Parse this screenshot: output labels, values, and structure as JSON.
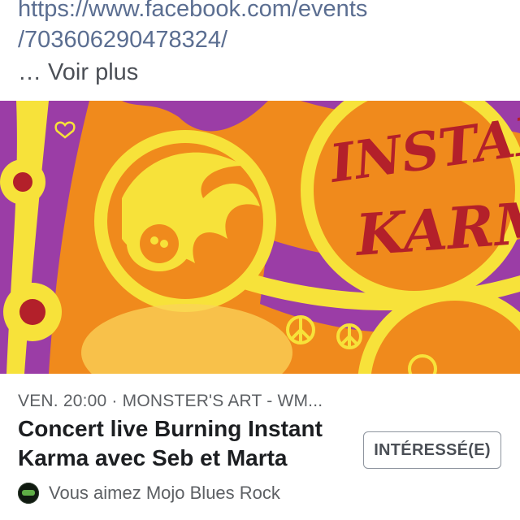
{
  "post": {
    "url_line1": "https://www.facebook.com/events",
    "url_line2": "/703606290478324/",
    "see_more": "… Voir plus"
  },
  "cover": {
    "alt_text": "INSTANT KARMA",
    "colors": {
      "orange": "#f08a1c",
      "yellow": "#f7e23a",
      "purple": "#9b3da6",
      "red": "#b3202a"
    }
  },
  "event": {
    "meta": "VEN. 20:00 · MONSTER'S ART - WM...",
    "title": "Concert live Burning Instant Karma avec Seb et Marta",
    "interested_label": "INTÉRESSÉ(E)",
    "social_text": "Vous aimez Mojo Blues Rock"
  }
}
